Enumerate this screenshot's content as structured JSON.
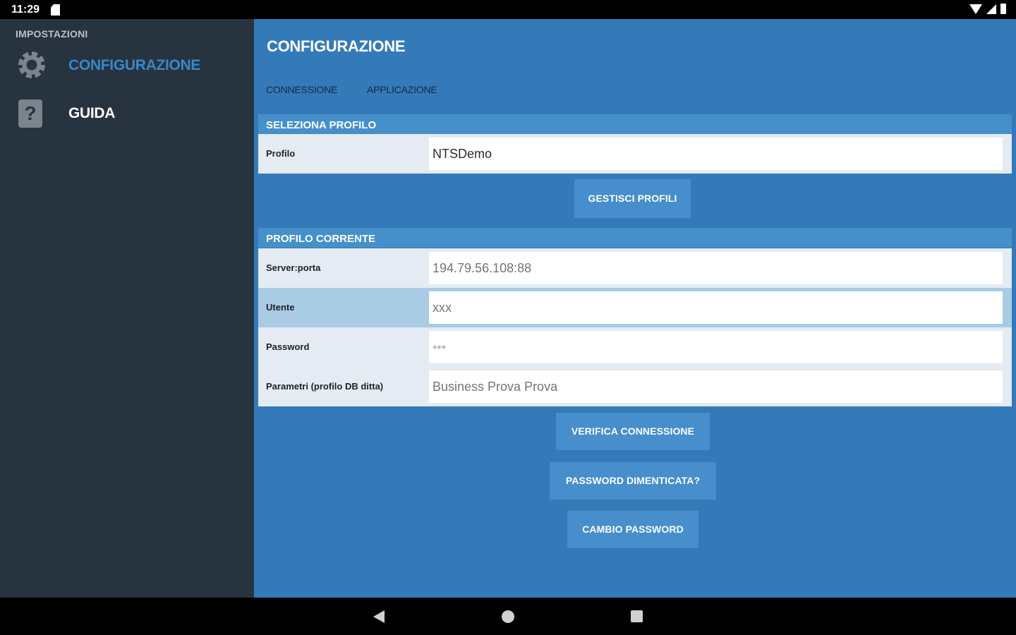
{
  "status_bar": {
    "time": "11:29"
  },
  "sidebar": {
    "header": "IMPOSTAZIONI",
    "items": [
      {
        "label": "CONFIGURAZIONE",
        "icon": "gear-icon",
        "active": true
      },
      {
        "label": "GUIDA",
        "icon": "help-icon",
        "active": false
      }
    ]
  },
  "main": {
    "title": "CONFIGURAZIONE",
    "tabs": [
      {
        "label": "CONNESSIONE"
      },
      {
        "label": "APPLICAZIONE"
      }
    ],
    "select_profile": {
      "header": "SELEZIONA PROFILO",
      "profile_label": "Profilo",
      "profile_value": "NTSDemo",
      "manage_button": "GESTISCI PROFILI"
    },
    "current_profile": {
      "header": "PROFILO CORRENTE",
      "fields": [
        {
          "label": "Server:porta",
          "placeholder": "194.79.56.108:88"
        },
        {
          "label": "Utente",
          "placeholder": "xxx"
        },
        {
          "label": "Password",
          "value": "•••"
        },
        {
          "label": "Parametri (profilo DB ditta)",
          "placeholder": "Business Prova Prova"
        }
      ]
    },
    "buttons": {
      "verify": "VERIFICA CONNESSIONE",
      "forgot": "PASSWORD DIMENTICATA?",
      "change": "CAMBIO PASSWORD"
    }
  },
  "colors": {
    "sidebar_bg": "#283340",
    "main_bg": "#357ab8",
    "accent": "#3a87c8",
    "section_header": "#4590cb",
    "button": "#468ecc"
  }
}
